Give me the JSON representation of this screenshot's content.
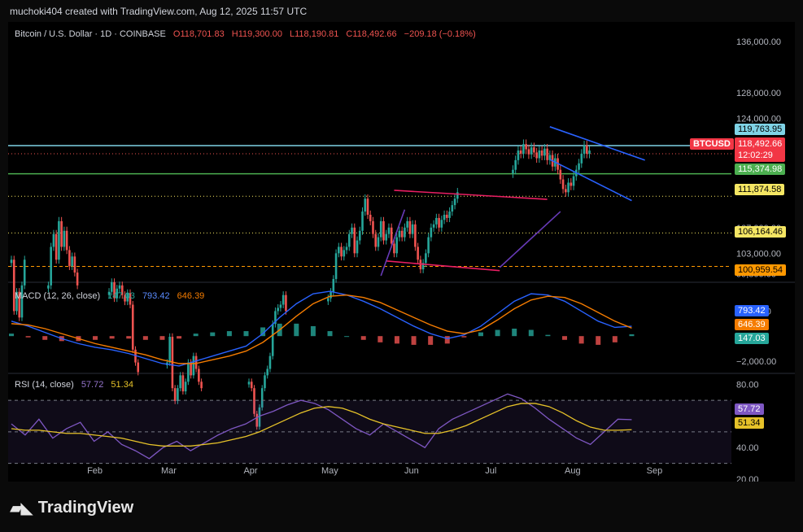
{
  "header": {
    "creator": "muchoki404 created with TradingView.com, Aug 12, 2025 11:57 UTC"
  },
  "footer": {
    "brand": "TradingView"
  },
  "colors": {
    "up": "#26a69a",
    "down": "#ef5350",
    "resistance": "#7fd3e6",
    "support": "#4caf50",
    "macd": "#2962ff",
    "signal": "#f57c00",
    "rsi": "#7e57c2",
    "rsi_ma": "#e6c229",
    "pink_channel": "#e91e63",
    "purple_line": "#673ab7",
    "blue_channel": "#2962ff"
  },
  "chart_data": [
    {
      "type": "candlestick",
      "title": "Bitcoin / U.S. Dollar · 1D · COINBASE",
      "ohlc_label": {
        "o": "O118,701.83",
        "h": "H119,300.00",
        "l": "L118,190.81",
        "c": "C118,492.66",
        "chg": "−209.18 (−0.18%)"
      },
      "yticks": [
        "136,000.00",
        "128,000.00",
        "124,000.00",
        "107,000.00",
        "103,000.00",
        "99,800.00"
      ],
      "xticks": [
        "Feb",
        "Mar",
        "Apr",
        "May",
        "Jun",
        "Jul",
        "Aug",
        "Sep"
      ],
      "ylim": [
        99500,
        138000
      ],
      "symbol_badge": "BTCUSD",
      "countdown": "12:02:29",
      "levels": [
        {
          "value": 119763.95,
          "label": "119,763.95",
          "style": "resistance"
        },
        {
          "value": 118492.66,
          "label": "118,492.66",
          "style": "last"
        },
        {
          "value": 115374.98,
          "label": "115,374.98",
          "style": "support"
        },
        {
          "value": 111874.58,
          "label": "111,874.58",
          "style": "dotted"
        },
        {
          "value": 106164.46,
          "label": "106,164.46",
          "style": "dotted"
        },
        {
          "value": 100959.54,
          "label": "100,959.54",
          "style": "dashed"
        }
      ],
      "segments": [
        {
          "start": "Jan 1",
          "points": [
            102000,
            94000,
            97000,
            93000,
            98000,
            102000
          ]
        },
        {
          "start": "Jan 15",
          "points": [
            98000,
            104000,
            106000,
            102000,
            108000,
            104000,
            106500,
            103500,
            101000,
            102500,
            100000,
            98000
          ]
        },
        {
          "start": "Feb 7",
          "points": [
            97000,
            98500,
            96000,
            97500,
            98000,
            96500,
            95500,
            96800,
            95000,
            88000,
            86000,
            84500
          ]
        },
        {
          "start": "Mar 1",
          "points": [
            86000,
            90000,
            82000,
            80000,
            82000,
            84000,
            81500,
            83000,
            86000,
            84000,
            87000,
            85000,
            83000,
            82000
          ]
        },
        {
          "start": "Apr 1",
          "points": [
            83000,
            82000,
            78000,
            76000,
            79000,
            82000,
            84000,
            85000,
            87000,
            92000,
            94000,
            94500,
            95000,
            96500,
            94000
          ]
        },
        {
          "start": "May 1",
          "points": [
            96000,
            97000,
            99000,
            103000,
            104000,
            102500,
            103500,
            104000,
            106000,
            107000,
            103000,
            105000,
            106500,
            109500,
            111500,
            109000,
            108000,
            106000,
            104000,
            105500,
            108000,
            105000,
            106000,
            107000,
            104500,
            103000,
            105500,
            106500,
            105500,
            107000,
            108000,
            106000,
            107500,
            104000,
            102000,
            100500,
            101500,
            103000,
            105500,
            107000,
            107500,
            108500,
            107000,
            108200,
            109000,
            108500,
            109500,
            110500,
            111500,
            112500
          ]
        },
        {
          "start": "Jul 10",
          "points": [
            116000,
            117500,
            119000,
            118500,
            120000,
            119200,
            118400,
            119500,
            118700,
            117800,
            119000,
            118200,
            119300,
            117500,
            118300,
            116500,
            117800,
            116000,
            114500,
            113000,
            112500,
            114000,
            113500,
            115000,
            116000,
            117000,
            118500,
            119800,
            118500,
            119000
          ]
        }
      ]
    },
    {
      "type": "line",
      "title": "MACD (12, 26, close)",
      "values_label": {
        "hist": "147.03",
        "macd": "793.42",
        "signal": "646.39"
      },
      "yticks": [
        "2,000.00",
        "−2,000.00"
      ],
      "series": [
        {
          "name": "MACD",
          "values": [
            1200,
            800,
            300,
            -200,
            -600,
            -900,
            -1100,
            -1400,
            -1800,
            -2200,
            -2400,
            -2000,
            -1600,
            -1200,
            -800,
            200,
            1500,
            2600,
            3400,
            3600,
            3300,
            2800,
            2200,
            1500,
            800,
            200,
            -200,
            100,
            800,
            1800,
            2800,
            3400,
            3300,
            2800,
            2000,
            1200,
            700,
            793
          ]
        },
        {
          "name": "Signal",
          "values": [
            1000,
            900,
            600,
            200,
            -200,
            -600,
            -900,
            -1200,
            -1500,
            -1900,
            -2200,
            -2200,
            -1900,
            -1600,
            -1200,
            -500,
            500,
            1600,
            2600,
            3200,
            3300,
            3100,
            2700,
            2100,
            1500,
            900,
            400,
            200,
            500,
            1300,
            2200,
            2900,
            3200,
            3100,
            2600,
            1900,
            1200,
            646
          ]
        },
        {
          "name": "Histogram",
          "values": [
            200,
            -100,
            -300,
            -400,
            -400,
            -300,
            -200,
            -200,
            -300,
            -300,
            -200,
            200,
            300,
            400,
            400,
            700,
            1000,
            1000,
            800,
            400,
            0,
            -300,
            -500,
            -600,
            -700,
            -700,
            -600,
            -100,
            300,
            500,
            600,
            500,
            100,
            -300,
            -600,
            -700,
            -500,
            147
          ]
        }
      ]
    },
    {
      "type": "line",
      "title": "RSI (14, close)",
      "values_label": {
        "rsi": "57.72",
        "ma": "51.34"
      },
      "yticks": [
        "80.00",
        "40.00",
        "20.00"
      ],
      "ylim": [
        20,
        85
      ],
      "series": [
        {
          "name": "RSI",
          "values": [
            55,
            48,
            58,
            46,
            52,
            56,
            44,
            50,
            42,
            38,
            33,
            40,
            44,
            38,
            43,
            48,
            52,
            55,
            60,
            63,
            67,
            70,
            68,
            64,
            58,
            52,
            48,
            55,
            50,
            45,
            40,
            52,
            58,
            62,
            66,
            70,
            74,
            71,
            65,
            58,
            52,
            46,
            42,
            50,
            58,
            57.72
          ]
        },
        {
          "name": "RSI MA",
          "values": [
            52,
            51,
            51,
            50,
            49,
            49,
            48,
            47,
            46,
            44,
            42,
            41,
            41,
            41,
            42,
            43,
            45,
            47,
            50,
            54,
            58,
            62,
            65,
            66,
            65,
            62,
            58,
            55,
            53,
            51,
            49,
            49,
            51,
            54,
            58,
            62,
            66,
            68,
            68,
            66,
            62,
            57,
            53,
            51,
            51,
            51.34
          ]
        }
      ]
    }
  ]
}
